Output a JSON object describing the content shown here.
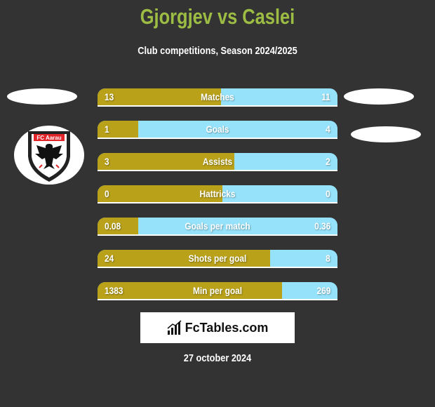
{
  "header": {
    "title": "Gjorgjev vs Caslei",
    "subtitle": "Club competitions, Season 2024/2025"
  },
  "team_left": {
    "name": "FC Aarau",
    "logo_text": "FC Aarau"
  },
  "colors": {
    "left_bar": "#b9a11a",
    "right_bar": "#95e2fa",
    "title": "#9cbc44",
    "background": "#333333"
  },
  "stats": [
    {
      "label": "Matches",
      "left": "13",
      "right": "11",
      "left_share": 0.515
    },
    {
      "label": "Goals",
      "left": "1",
      "right": "4",
      "left_share": 0.17
    },
    {
      "label": "Assists",
      "left": "3",
      "right": "2",
      "left_share": 0.57
    },
    {
      "label": "Hattricks",
      "left": "0",
      "right": "0",
      "left_share": 0.52
    },
    {
      "label": "Goals per match",
      "left": "0.08",
      "right": "0.36",
      "left_share": 0.17
    },
    {
      "label": "Shots per goal",
      "left": "24",
      "right": "8",
      "left_share": 0.72
    },
    {
      "label": "Min per goal",
      "left": "1383",
      "right": "269",
      "left_share": 0.77
    }
  ],
  "brand": {
    "name": "FcTables.com",
    "icon": "bar-chart-icon"
  },
  "date": "27 october 2024"
}
